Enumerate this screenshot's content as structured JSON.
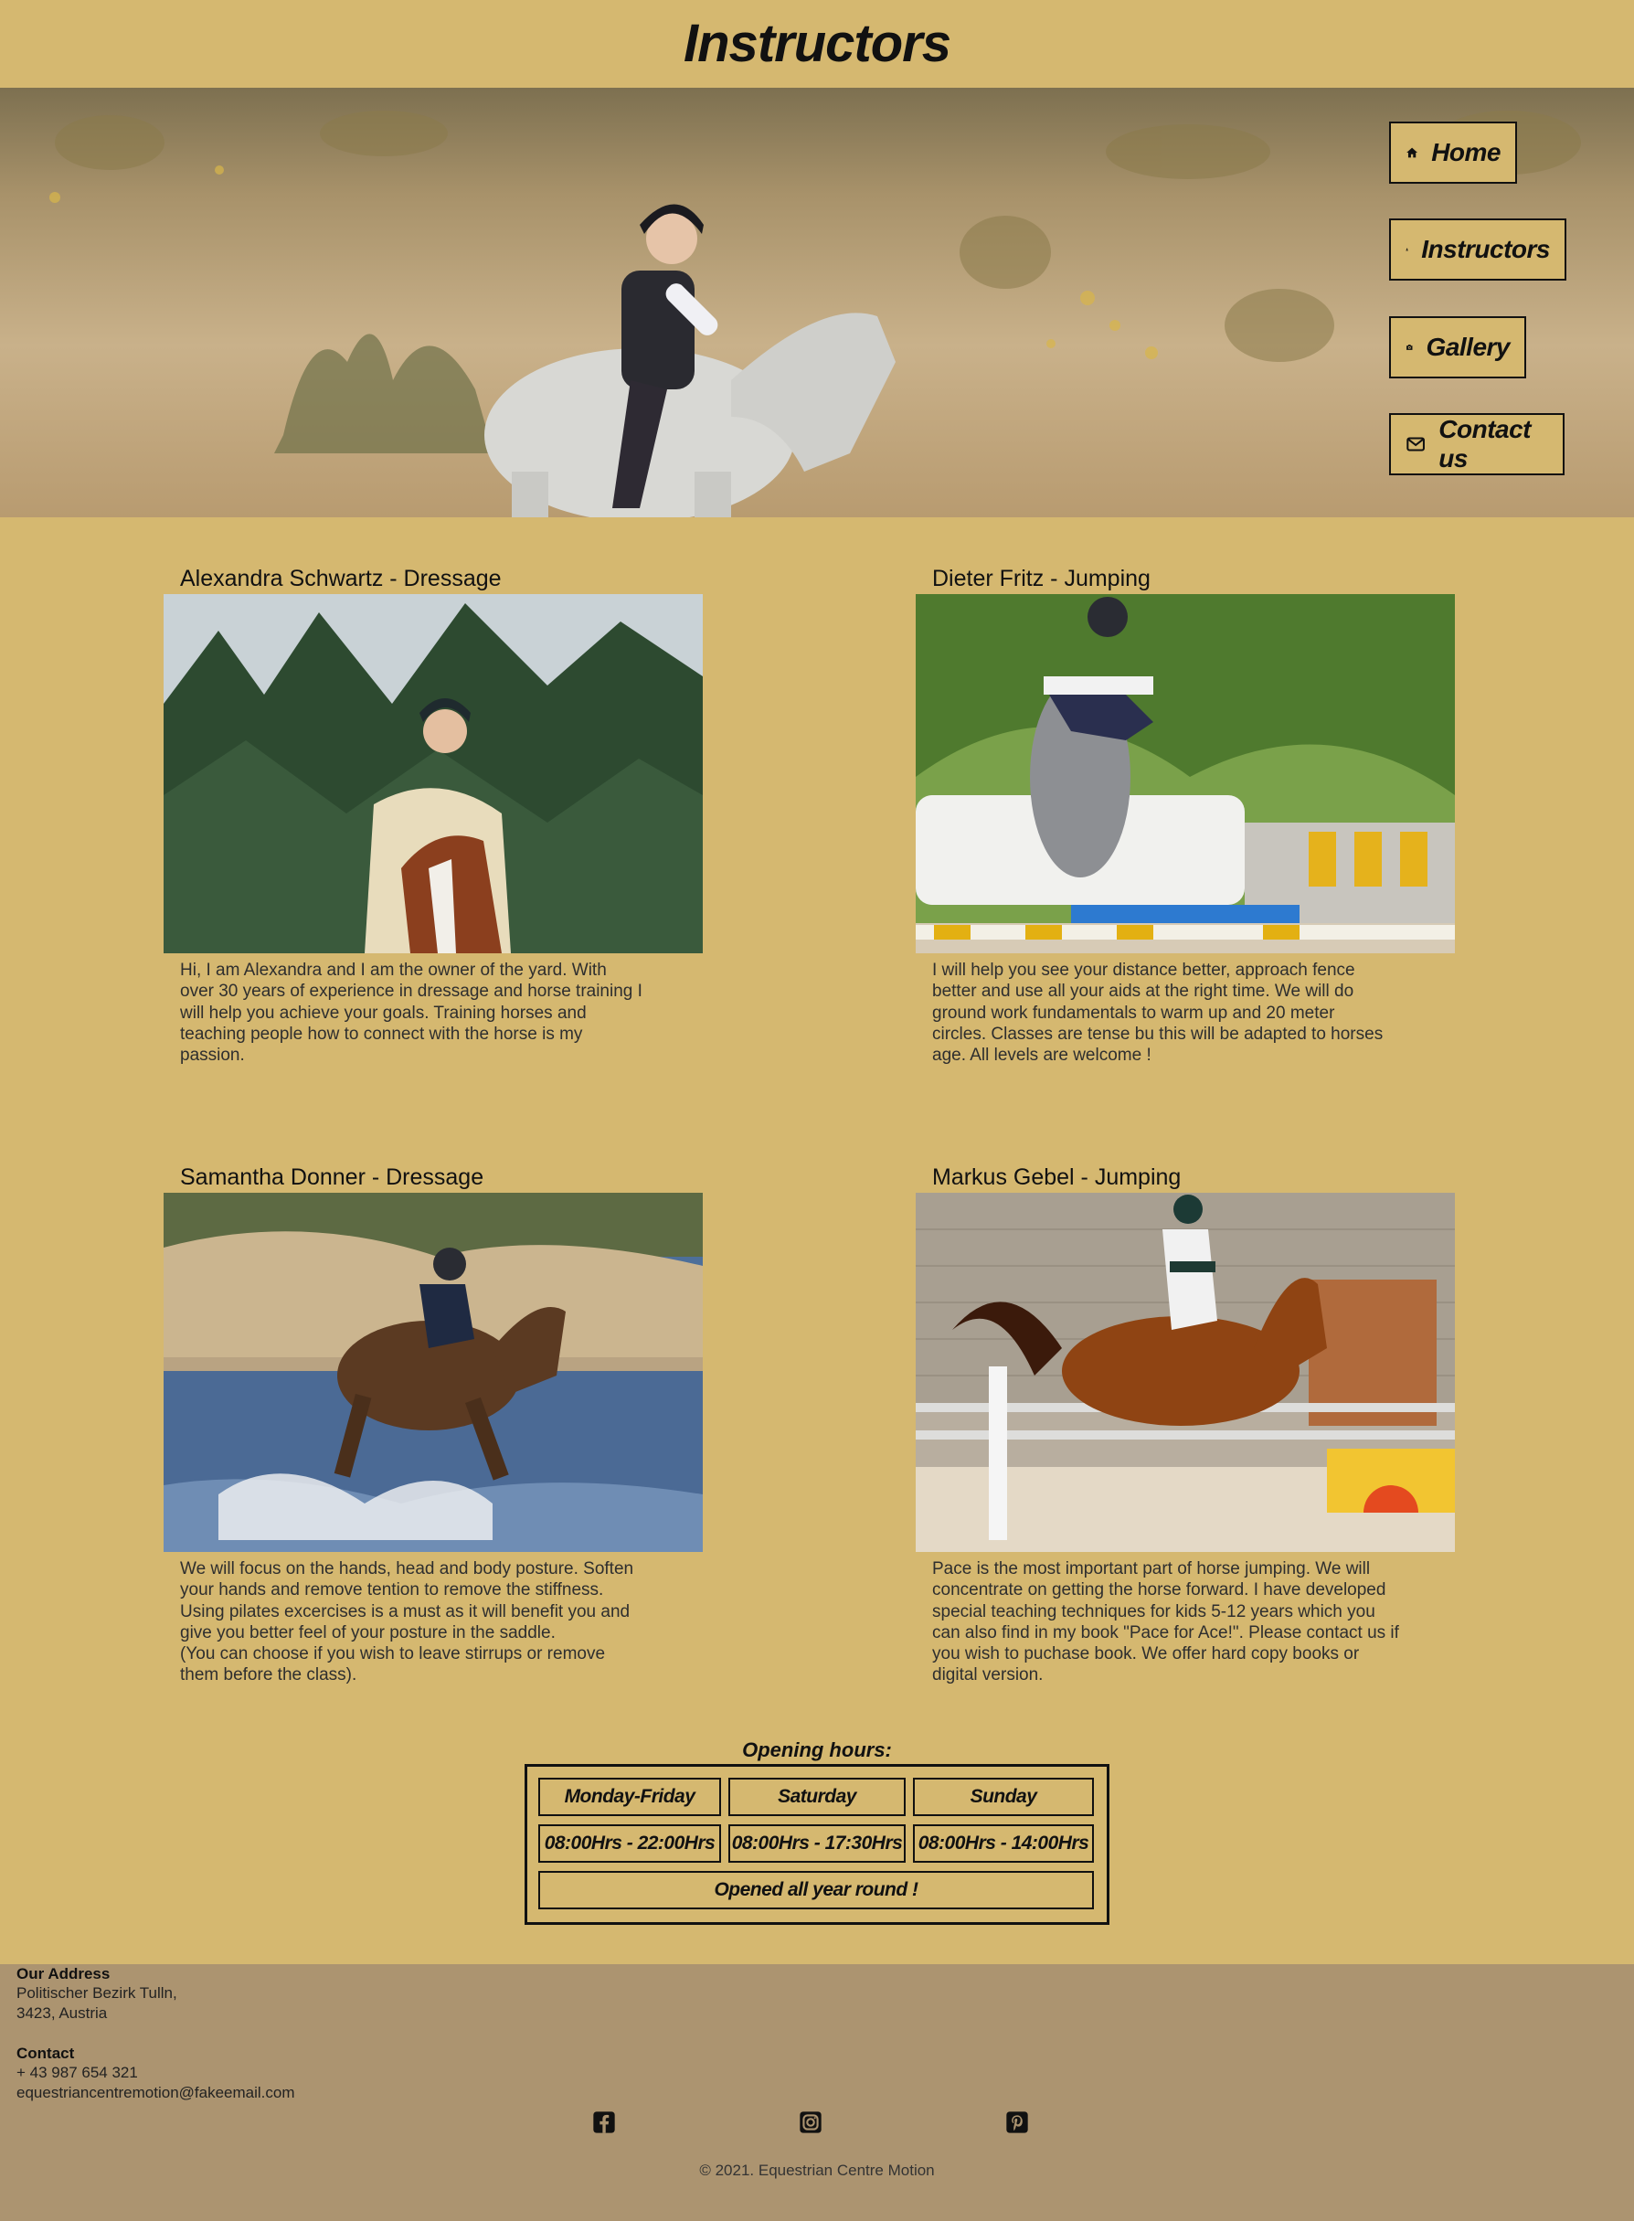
{
  "header": {
    "title": "Instructors"
  },
  "nav": [
    {
      "label": "Home",
      "icon": "home-icon"
    },
    {
      "label": "Instructors",
      "icon": "user-icon"
    },
    {
      "label": "Gallery",
      "icon": "camera-icon"
    },
    {
      "label": "Contact us",
      "icon": "envelope-icon"
    }
  ],
  "instructors": [
    {
      "title": "Alexandra Schwartz - Dressage",
      "text": "Hi, I am Alexandra and I am the owner of the yard. With\nover 30 years of experience in dressage and horse training I\nwill help you achieve your goals. Training horses and\nteaching people how to connect with the horse is my\npassion."
    },
    {
      "title": "Dieter Fritz - Jumping",
      "text": "I will help you see your distance better, approach fence\nbetter and use all your aids at the right time. We will do\nground work fundamentals to warm up and 20 meter\ncircles. Classes are tense bu this will be adapted to horses\nage. All levels are welcome !"
    },
    {
      "title": "Samantha Donner - Dressage",
      "text": "We will focus on the hands, head and body posture. Soften\nyour hands and remove tention to remove the stiffness.\nUsing pilates excercises is a must as it will benefit you and\ngive you better feel of your posture in the saddle.\n(You can choose if you wish to leave stirrups or remove\nthem before the class)."
    },
    {
      "title": "Markus Gebel - Jumping",
      "text": "Pace is the most important part of horse jumping. We will\nconcentrate on getting the horse forward. I have developed\nspecial teaching techniques for kids 5-12 years which you\ncan also find in my book \"Pace for Ace!\". Please contact us if\nyou wish to puchase book. We offer hard copy books or\ndigital version."
    }
  ],
  "opening_hours": {
    "title": "Opening hours:",
    "days": [
      "Monday-Friday",
      "Saturday",
      "Sunday"
    ],
    "hours": [
      "08:00Hrs - 22:00Hrs",
      "08:00Hrs - 17:30Hrs",
      "08:00Hrs - 14:00Hrs"
    ],
    "note": "Opened all year round !"
  },
  "footer": {
    "address_heading": "Our Address",
    "address_lines": [
      "Politischer Bezirk Tulln,",
      "3423, Austria"
    ],
    "contact_heading": "Contact",
    "phone": "+ 43 987 654 321",
    "email": "equestriancentremotion@fakeemail.com",
    "social": [
      "facebook-icon",
      "instagram-icon",
      "pinterest-icon"
    ],
    "copyright": "© 2021. Equestrian Centre Motion"
  },
  "colors": {
    "page_bg": "#d5b870",
    "footer_bg": "#ac9470",
    "text": "#111111"
  }
}
